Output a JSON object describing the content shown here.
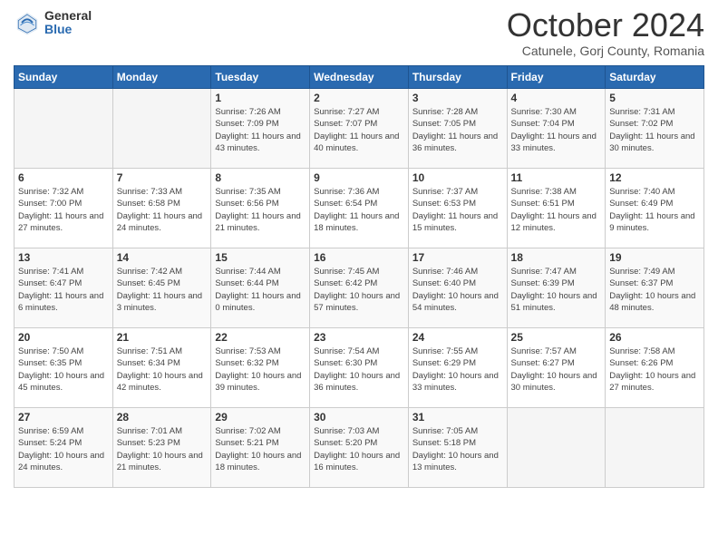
{
  "logo": {
    "general": "General",
    "blue": "Blue"
  },
  "title": "October 2024",
  "subtitle": "Catunele, Gorj County, Romania",
  "days_header": [
    "Sunday",
    "Monday",
    "Tuesday",
    "Wednesday",
    "Thursday",
    "Friday",
    "Saturday"
  ],
  "weeks": [
    [
      {
        "day": "",
        "sunrise": "",
        "sunset": "",
        "daylight": ""
      },
      {
        "day": "",
        "sunrise": "",
        "sunset": "",
        "daylight": ""
      },
      {
        "day": "1",
        "sunrise": "Sunrise: 7:26 AM",
        "sunset": "Sunset: 7:09 PM",
        "daylight": "Daylight: 11 hours and 43 minutes."
      },
      {
        "day": "2",
        "sunrise": "Sunrise: 7:27 AM",
        "sunset": "Sunset: 7:07 PM",
        "daylight": "Daylight: 11 hours and 40 minutes."
      },
      {
        "day": "3",
        "sunrise": "Sunrise: 7:28 AM",
        "sunset": "Sunset: 7:05 PM",
        "daylight": "Daylight: 11 hours and 36 minutes."
      },
      {
        "day": "4",
        "sunrise": "Sunrise: 7:30 AM",
        "sunset": "Sunset: 7:04 PM",
        "daylight": "Daylight: 11 hours and 33 minutes."
      },
      {
        "day": "5",
        "sunrise": "Sunrise: 7:31 AM",
        "sunset": "Sunset: 7:02 PM",
        "daylight": "Daylight: 11 hours and 30 minutes."
      }
    ],
    [
      {
        "day": "6",
        "sunrise": "Sunrise: 7:32 AM",
        "sunset": "Sunset: 7:00 PM",
        "daylight": "Daylight: 11 hours and 27 minutes."
      },
      {
        "day": "7",
        "sunrise": "Sunrise: 7:33 AM",
        "sunset": "Sunset: 6:58 PM",
        "daylight": "Daylight: 11 hours and 24 minutes."
      },
      {
        "day": "8",
        "sunrise": "Sunrise: 7:35 AM",
        "sunset": "Sunset: 6:56 PM",
        "daylight": "Daylight: 11 hours and 21 minutes."
      },
      {
        "day": "9",
        "sunrise": "Sunrise: 7:36 AM",
        "sunset": "Sunset: 6:54 PM",
        "daylight": "Daylight: 11 hours and 18 minutes."
      },
      {
        "day": "10",
        "sunrise": "Sunrise: 7:37 AM",
        "sunset": "Sunset: 6:53 PM",
        "daylight": "Daylight: 11 hours and 15 minutes."
      },
      {
        "day": "11",
        "sunrise": "Sunrise: 7:38 AM",
        "sunset": "Sunset: 6:51 PM",
        "daylight": "Daylight: 11 hours and 12 minutes."
      },
      {
        "day": "12",
        "sunrise": "Sunrise: 7:40 AM",
        "sunset": "Sunset: 6:49 PM",
        "daylight": "Daylight: 11 hours and 9 minutes."
      }
    ],
    [
      {
        "day": "13",
        "sunrise": "Sunrise: 7:41 AM",
        "sunset": "Sunset: 6:47 PM",
        "daylight": "Daylight: 11 hours and 6 minutes."
      },
      {
        "day": "14",
        "sunrise": "Sunrise: 7:42 AM",
        "sunset": "Sunset: 6:45 PM",
        "daylight": "Daylight: 11 hours and 3 minutes."
      },
      {
        "day": "15",
        "sunrise": "Sunrise: 7:44 AM",
        "sunset": "Sunset: 6:44 PM",
        "daylight": "Daylight: 11 hours and 0 minutes."
      },
      {
        "day": "16",
        "sunrise": "Sunrise: 7:45 AM",
        "sunset": "Sunset: 6:42 PM",
        "daylight": "Daylight: 10 hours and 57 minutes."
      },
      {
        "day": "17",
        "sunrise": "Sunrise: 7:46 AM",
        "sunset": "Sunset: 6:40 PM",
        "daylight": "Daylight: 10 hours and 54 minutes."
      },
      {
        "day": "18",
        "sunrise": "Sunrise: 7:47 AM",
        "sunset": "Sunset: 6:39 PM",
        "daylight": "Daylight: 10 hours and 51 minutes."
      },
      {
        "day": "19",
        "sunrise": "Sunrise: 7:49 AM",
        "sunset": "Sunset: 6:37 PM",
        "daylight": "Daylight: 10 hours and 48 minutes."
      }
    ],
    [
      {
        "day": "20",
        "sunrise": "Sunrise: 7:50 AM",
        "sunset": "Sunset: 6:35 PM",
        "daylight": "Daylight: 10 hours and 45 minutes."
      },
      {
        "day": "21",
        "sunrise": "Sunrise: 7:51 AM",
        "sunset": "Sunset: 6:34 PM",
        "daylight": "Daylight: 10 hours and 42 minutes."
      },
      {
        "day": "22",
        "sunrise": "Sunrise: 7:53 AM",
        "sunset": "Sunset: 6:32 PM",
        "daylight": "Daylight: 10 hours and 39 minutes."
      },
      {
        "day": "23",
        "sunrise": "Sunrise: 7:54 AM",
        "sunset": "Sunset: 6:30 PM",
        "daylight": "Daylight: 10 hours and 36 minutes."
      },
      {
        "day": "24",
        "sunrise": "Sunrise: 7:55 AM",
        "sunset": "Sunset: 6:29 PM",
        "daylight": "Daylight: 10 hours and 33 minutes."
      },
      {
        "day": "25",
        "sunrise": "Sunrise: 7:57 AM",
        "sunset": "Sunset: 6:27 PM",
        "daylight": "Daylight: 10 hours and 30 minutes."
      },
      {
        "day": "26",
        "sunrise": "Sunrise: 7:58 AM",
        "sunset": "Sunset: 6:26 PM",
        "daylight": "Daylight: 10 hours and 27 minutes."
      }
    ],
    [
      {
        "day": "27",
        "sunrise": "Sunrise: 6:59 AM",
        "sunset": "Sunset: 5:24 PM",
        "daylight": "Daylight: 10 hours and 24 minutes."
      },
      {
        "day": "28",
        "sunrise": "Sunrise: 7:01 AM",
        "sunset": "Sunset: 5:23 PM",
        "daylight": "Daylight: 10 hours and 21 minutes."
      },
      {
        "day": "29",
        "sunrise": "Sunrise: 7:02 AM",
        "sunset": "Sunset: 5:21 PM",
        "daylight": "Daylight: 10 hours and 18 minutes."
      },
      {
        "day": "30",
        "sunrise": "Sunrise: 7:03 AM",
        "sunset": "Sunset: 5:20 PM",
        "daylight": "Daylight: 10 hours and 16 minutes."
      },
      {
        "day": "31",
        "sunrise": "Sunrise: 7:05 AM",
        "sunset": "Sunset: 5:18 PM",
        "daylight": "Daylight: 10 hours and 13 minutes."
      },
      {
        "day": "",
        "sunrise": "",
        "sunset": "",
        "daylight": ""
      },
      {
        "day": "",
        "sunrise": "",
        "sunset": "",
        "daylight": ""
      }
    ]
  ]
}
